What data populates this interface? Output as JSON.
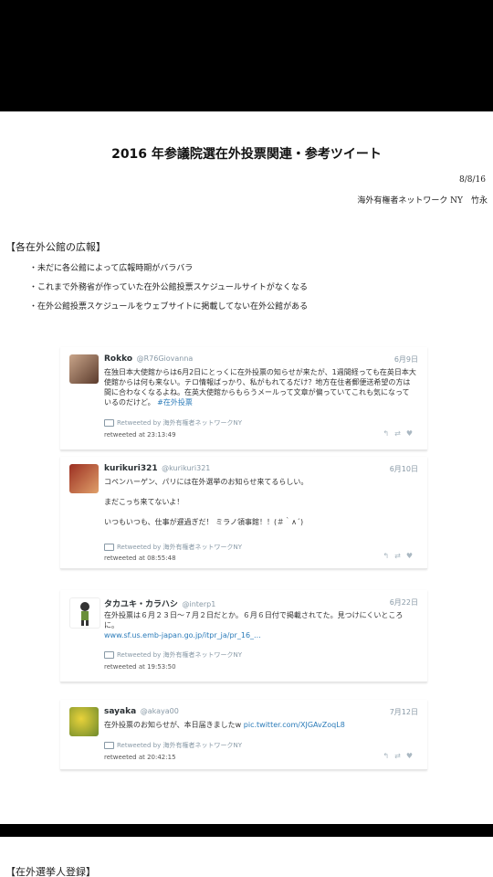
{
  "doc": {
    "title": "2016 年参議院選在外投票関連・参考ツイート",
    "date": "8/8/16",
    "author": "海外有権者ネットワーク NY　竹永",
    "section1": "【各在外公館の広報】",
    "bullets": [
      "未だに各公館によって広報時期がバラバラ",
      "これまで外務省が作っていた在外公館投票スケジュールサイトがなくなる",
      "在外公館投票スケジュールをウェブサイトに掲載してない在外公館がある"
    ],
    "section2": "【在外選挙人登録】"
  },
  "tweets": [
    {
      "name": "Rokko",
      "handle": "@R76Giovanna",
      "date": "6月9日",
      "body": "在独日本大使館からは6月2日にとっくに在外投票の知らせが来たが、1週間経っても在英日本大使館からは何も来ない。テロ情報ばっかり、私がもれてるだけ？地方在住者郵便送希望の方は間に合わなくなるよね。在英大使館からもらうメールって文章が偏っていてこれも気になっているのだけど。",
      "hashtag": "#在外投票",
      "retweeted_by": "Retweeted by 海外有権者ネットワークNY",
      "retweeted_at": "retweeted at 23:13:49"
    },
    {
      "name": "kurikuri321",
      "handle": "@kurikuri321",
      "date": "6月10日",
      "body1": "コペンハーゲン、パリには在外選挙のお知らせ来てるらしい。",
      "body2": "まだこっち来てないよ！",
      "body3": "いつもいつも、仕事が遅過ぎだ！ ミラノ領事館！！(＃｀∧´)",
      "retweeted_by": "Retweeted by 海外有権者ネットワークNY",
      "retweeted_at": "retweeted at 08:55:48"
    },
    {
      "name": "タカユキ・カラハシ",
      "handle": "@interp1",
      "date": "6月22日",
      "body": "在外投票は６月２３日〜７月２日だとか。６月６日付で掲載されてた。見つけにくいところに。",
      "link": "www.sf.us.emb-japan.go.jp/itpr_ja/pr_16_...",
      "retweeted_by": "Retweeted by 海外有権者ネットワークNY",
      "retweeted_at": "retweeted at 19:53:50"
    },
    {
      "name": "sayaka",
      "handle": "@akaya00",
      "date": "7月12日",
      "body": "在外投票のお知らせが、本日届きましたw",
      "link": "pic.twitter.com/XJGAvZoqL8",
      "retweeted_by": "Retweeted by 海外有権者ネットワークNY",
      "retweeted_at": "retweeted at 20:42:15"
    }
  ],
  "icons": [
    "reply-icon",
    "retweet-icon",
    "like-icon",
    "retweet-badge-icon"
  ],
  "colors": {
    "link": "#2b7bb9",
    "muted": "#8899a6",
    "band": "#000000"
  }
}
